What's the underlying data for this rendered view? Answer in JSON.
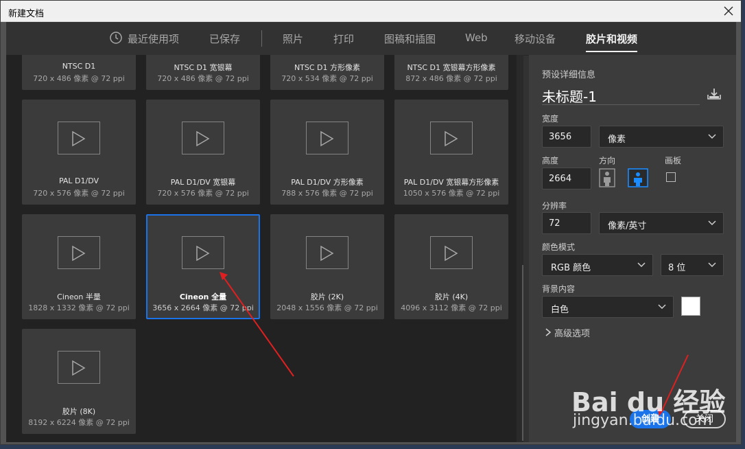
{
  "window": {
    "title": "新建文档"
  },
  "tabs": [
    {
      "label": "最近使用项"
    },
    {
      "label": "已保存"
    },
    {
      "label": "照片"
    },
    {
      "label": "打印"
    },
    {
      "label": "图稿和插图"
    },
    {
      "label": "Web"
    },
    {
      "label": "移动设备"
    },
    {
      "label": "胶片和视频"
    }
  ],
  "presets": [
    {
      "name": "NTSC D1",
      "size": "720 x 486 像素 @ 72 ppi"
    },
    {
      "name": "NTSC D1 宽银幕",
      "size": "720 x 486 像素 @ 72 ppi"
    },
    {
      "name": "NTSC D1 方形像素",
      "size": "720 x 534 像素 @ 72 ppi"
    },
    {
      "name": "NTSC D1 宽银幕方形像素",
      "size": "872 x 486 像素 @ 72 ppi"
    },
    {
      "name": "PAL D1/DV",
      "size": "720 x 576 像素 @ 72 ppi"
    },
    {
      "name": "PAL D1/DV 宽银幕",
      "size": "720 x 576 像素 @ 72 ppi"
    },
    {
      "name": "PAL D1/DV 方形像素",
      "size": "788 x 576 像素 @ 72 ppi"
    },
    {
      "name": "PAL D1/DV 宽银幕方形像素",
      "size": "1050 x 576 像素 @ 72 ppi"
    },
    {
      "name": "Cineon 半量",
      "size": "1828 x 1332 像素 @ 72 ppi"
    },
    {
      "name": "Cineon 全量",
      "size": "3656 x 2664 像素 @ 72 ppi"
    },
    {
      "name": "胶片 (2K)",
      "size": "2048 x 1556 像素 @ 72 ppi"
    },
    {
      "name": "胶片 (4K)",
      "size": "4096 x 3112 像素 @ 72 ppi"
    },
    {
      "name": "胶片 (8K)",
      "size": "8192 x 6224 像素 @ 72 ppi"
    }
  ],
  "details": {
    "heading": "预设详细信息",
    "doc_name": "未标题-1",
    "width_label": "宽度",
    "width_value": "3656",
    "width_unit": "像素",
    "height_label": "高度",
    "height_value": "2664",
    "orientation_label": "方向",
    "artboard_label": "画板",
    "resolution_label": "分辨率",
    "resolution_value": "72",
    "resolution_unit": "像素/英寸",
    "color_mode_label": "颜色模式",
    "color_mode_value": "RGB 颜色",
    "bit_depth_value": "8 位",
    "background_label": "背景内容",
    "background_value": "白色",
    "advanced_label": "高级选项"
  },
  "buttons": {
    "create": "创建",
    "close": "关闭"
  },
  "watermark": {
    "brand": "Bai du 经验",
    "url": "jingyan.baidu.com"
  },
  "colors": {
    "accent": "#1a73e8",
    "annotation_arrow": "#e02020"
  }
}
